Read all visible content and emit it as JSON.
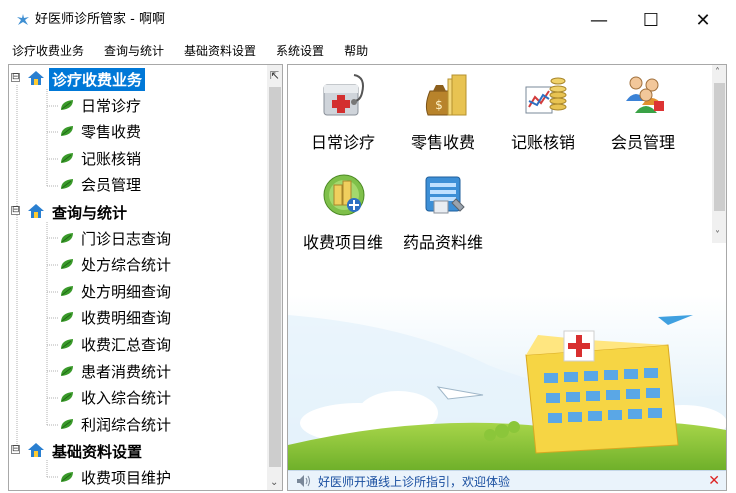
{
  "window": {
    "title": "好医师诊所管家 - 啊啊",
    "minimize_glyph": "—",
    "maximize_glyph": "☐",
    "close_glyph": "✕"
  },
  "menu": [
    {
      "label": "诊疗收费业务"
    },
    {
      "label": "查询与统计"
    },
    {
      "label": "基础资料设置"
    },
    {
      "label": "系统设置"
    },
    {
      "label": "帮助"
    }
  ],
  "tree": {
    "categories": [
      {
        "label": "诊疗收费业务",
        "selected": true,
        "items": [
          "日常诊疗",
          "零售收费",
          "记账核销",
          "会员管理"
        ]
      },
      {
        "label": "查询与统计",
        "selected": false,
        "items": [
          "门诊日志查询",
          "处方综合统计",
          "处方明细查询",
          "收费明细查询",
          "收费汇总查询",
          "患者消费统计",
          "收入综合统计",
          "利润综合统计"
        ]
      },
      {
        "label": "基础资料设置",
        "selected": false,
        "items": [
          "收费项目维护"
        ]
      }
    ],
    "expander_glyph": "⊟",
    "collapse_glyph": "⇱",
    "scroll_down_glyph": "⌄"
  },
  "tiles": [
    {
      "label": "日常诊疗",
      "icon": "medical-kit-icon"
    },
    {
      "label": "零售收费",
      "icon": "money-bag-icon"
    },
    {
      "label": "记账核销",
      "icon": "ledger-chart-icon"
    },
    {
      "label": "会员管理",
      "icon": "members-icon"
    },
    {
      "label": "收费项目维",
      "icon": "coins-plus-icon"
    },
    {
      "label": "药品资料维",
      "icon": "drug-database-icon"
    }
  ],
  "right_scroll": {
    "up_glyph": "˄",
    "down_glyph": "˅"
  },
  "notice": {
    "text": "好医师开通线上诊所指引，欢迎体验",
    "close_glyph": "✕"
  },
  "colors": {
    "selection": "#0078d7",
    "leaf_green": "#3a9a2a",
    "home_blue": "#2a7fd0",
    "notice_text": "#1a4fa0"
  }
}
